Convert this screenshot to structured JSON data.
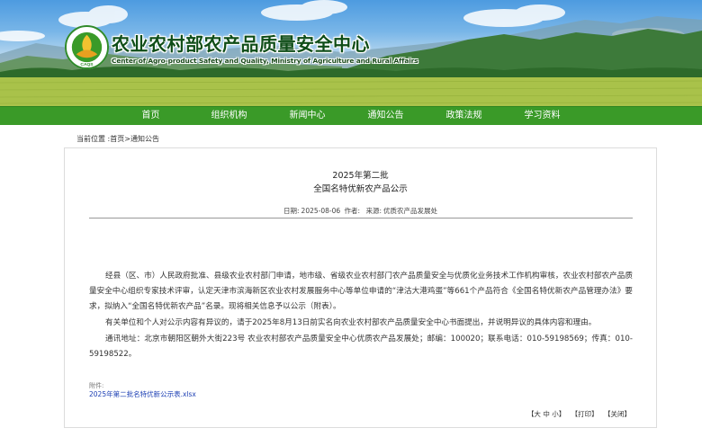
{
  "header": {
    "title": "农业农村部农产品质量安全中心",
    "subtitle": "Center of Agro-product Safety and Quality, Ministry of Agriculture and Rural Affairs",
    "logo_ring_text": "农业农村部农产品质量安全中心",
    "logo_badge": "CAQS"
  },
  "nav": {
    "items": [
      "首页",
      "组织机构",
      "新闻中心",
      "通知公告",
      "政策法规",
      "学习资料"
    ]
  },
  "breadcrumb": {
    "prefix": "当前位置 :",
    "home": "首页",
    "separator": ">",
    "current": "通知公告"
  },
  "article": {
    "title_line1": "2025年第二批",
    "title_line2": "全国名特优新农产品公示",
    "meta": {
      "date_label": "日期:",
      "date": "2025-08-06",
      "author_label": "作者:",
      "author": "",
      "source_label": "来源:",
      "source": "优质农产品发展处"
    },
    "paragraphs": [
      "经县（区、市）人民政府批准、县级农业农村部门申请，地市级、省级农业农村部门农产品质量安全与优质化业务技术工作机构审核，农业农村部农产品质量安全中心组织专家技术评审，认定天津市滨海新区农业农村发展服务中心等单位申请的“津沽大港鸡蛋”等661个产品符合《全国名特优新农产品管理办法》要求，拟纳入“全国名特优新农产品”名录。现将相关信息予以公示（附表）。",
      "有关单位和个人对公示内容有异议的，请于2025年8月13日前实名向农业农村部农产品质量安全中心书面提出，并说明异议的具体内容和理由。",
      "通讯地址：北京市朝阳区朝外大街223号 农业农村部农产品质量安全中心优质农产品发展处；邮编：100020；联系电话：010-59198569；传真：010-59198522。"
    ],
    "attachment_label": "附件:",
    "attachment_link": "2025年第二批名特优新公示表.xlsx",
    "tools": [
      "【大 中 小】",
      "【打印】",
      "【关闭】"
    ]
  },
  "colors": {
    "nav_green": "#3a9a28",
    "title_green": "#0f4d18",
    "link_blue": "#1e40b4"
  }
}
